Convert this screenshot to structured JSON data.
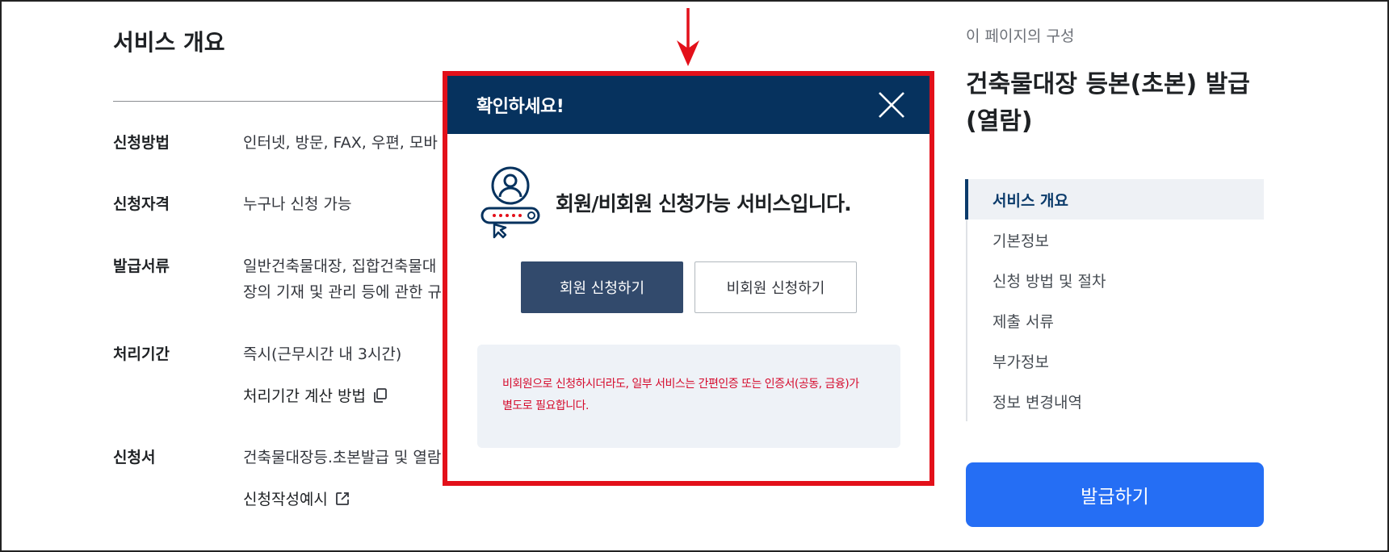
{
  "main": {
    "section_title": "서비스 개요",
    "rows": [
      {
        "label": "신청방법",
        "value": "인터넷, 방문, FAX, 우편, 모바"
      },
      {
        "label": "신청자격",
        "value": "누구나 신청 가능"
      },
      {
        "label": "발급서류",
        "value_line1": "일반건축물대장, 집합건축물대",
        "value_line2": "장의 기재 및 관리 등에 관한 규"
      },
      {
        "label": "처리기간",
        "value": "즉시(근무시간 내 3시간)",
        "link": "처리기간 계산 방법"
      },
      {
        "label": "신청서",
        "value": "건축물대장등.초본발급 및 열람",
        "link": "신청작성예시"
      }
    ]
  },
  "aside": {
    "caption": "이 페이지의 구성",
    "title": "건축물대장 등본(초본) 발급(열람)",
    "toc": [
      "서비스 개요",
      "기본정보",
      "신청 방법 및 절차",
      "제출 서류",
      "부가정보",
      "정보 변경내역"
    ],
    "active_index": 0,
    "issue_button": "발급하기"
  },
  "modal": {
    "title": "확인하세요!",
    "notice": "회원/비회원 신청가능 서비스입니다.",
    "member_button": "회원 신청하기",
    "guest_button": "비회원 신청하기",
    "info_line1": "비회원으로 신청하시더라도, 일부 서비스는 간편인증 또는 인증서(공동, 금융)가",
    "info_line2": "별도로 필요합니다."
  },
  "colors": {
    "modal_header": "#06325e",
    "highlight": "#e3101a",
    "primary_button": "#256ef4",
    "member_button": "#324a6c",
    "info_text": "#d50c2e"
  },
  "icons": [
    "close-icon",
    "copy-icon",
    "external-link-icon",
    "user-login-icon",
    "arrow-down-icon"
  ]
}
